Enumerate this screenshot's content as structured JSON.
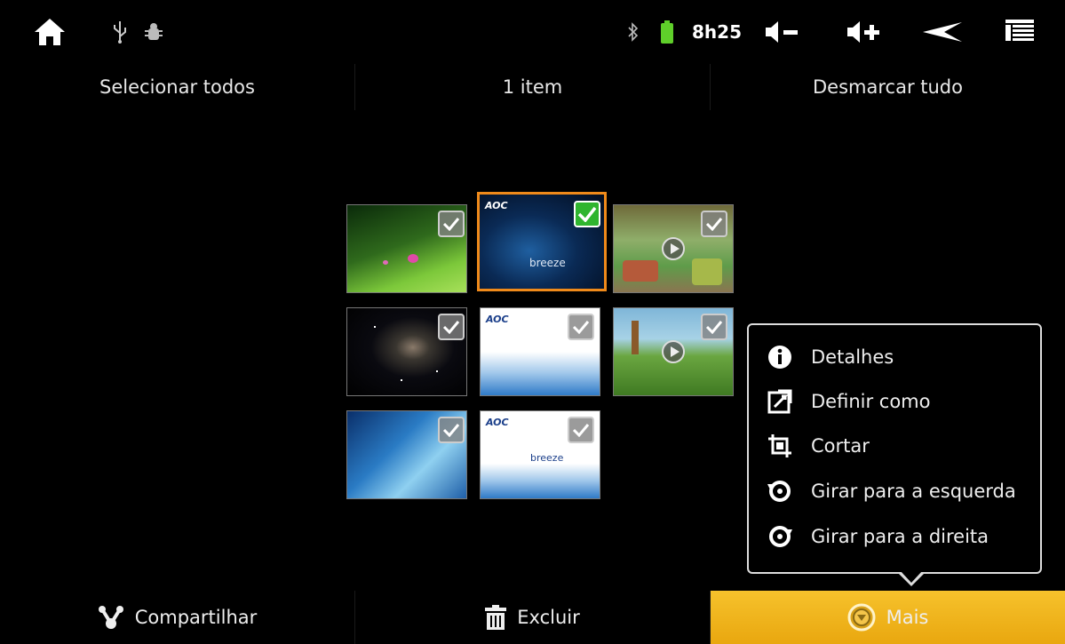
{
  "status_bar": {
    "time": "8h25",
    "icons": [
      "home-icon",
      "usb-icon",
      "debug-icon",
      "bluetooth-icon",
      "battery-icon",
      "volume-down-icon",
      "volume-up-icon",
      "back-icon",
      "menu-icon"
    ]
  },
  "action_bar": {
    "select_all": "Selecionar todos",
    "count": "1 item",
    "deselect_all": "Desmarcar tudo"
  },
  "gallery": {
    "items": [
      {
        "type": "photo",
        "label": "",
        "selected": false
      },
      {
        "type": "photo",
        "label": "AOC",
        "selected": true
      },
      {
        "type": "video",
        "label": "",
        "selected": false
      },
      {
        "type": "photo",
        "label": "",
        "selected": false
      },
      {
        "type": "photo",
        "label": "AOC",
        "selected": false
      },
      {
        "type": "video",
        "label": "",
        "selected": false
      },
      {
        "type": "photo",
        "label": "",
        "selected": false
      },
      {
        "type": "photo",
        "label": "AOC",
        "selected": false
      }
    ],
    "thumb_text": {
      "aoc": "AOC",
      "breeze": "breeze"
    }
  },
  "menu": {
    "details": "Detalhes",
    "set_as": "Definir como",
    "crop": "Cortar",
    "rotate_left": "Girar para a esquerda",
    "rotate_right": "Girar para a direita"
  },
  "bottom_bar": {
    "share": "Compartilhar",
    "delete": "Excluir",
    "more": "Mais"
  },
  "colors": {
    "accent_selection": "#f08a1a",
    "more_button": "#f2b620",
    "check_on": "#2fb52f"
  }
}
